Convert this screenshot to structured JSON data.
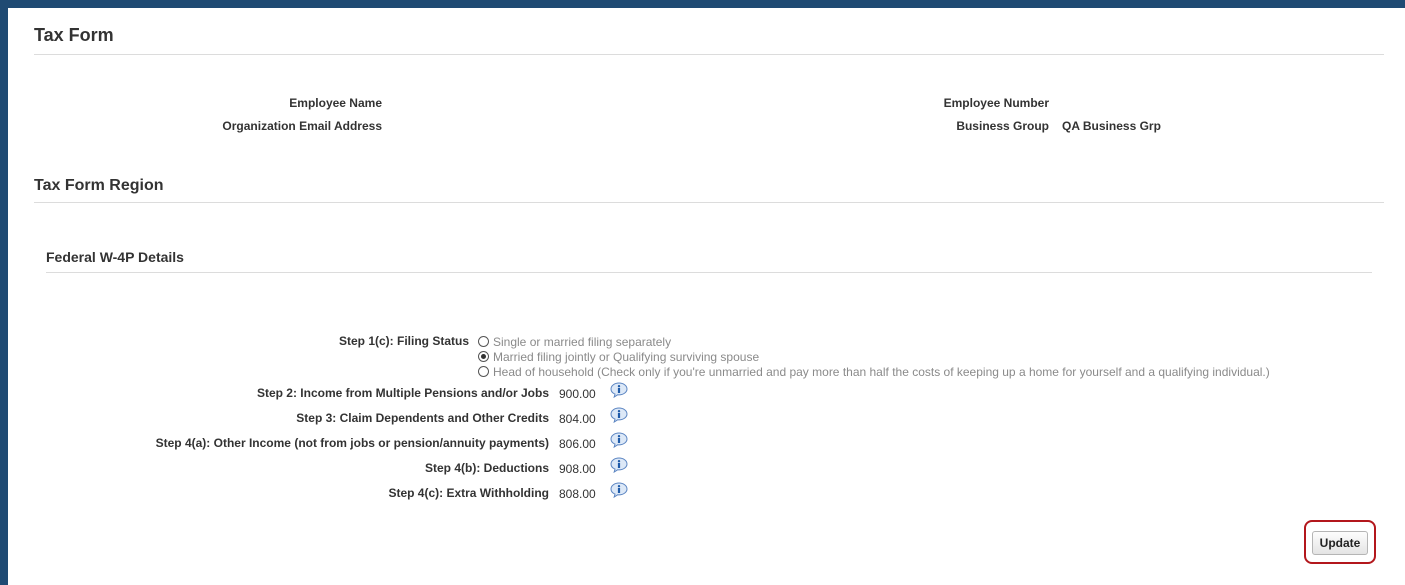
{
  "header": {
    "title": "Tax Form"
  },
  "employee": {
    "name_label": "Employee Name",
    "name_value": "",
    "email_label": "Organization Email Address",
    "email_value": "",
    "number_label": "Employee Number",
    "number_value": "",
    "business_group_label": "Business Group",
    "business_group_value": "QA Business Grp"
  },
  "region": {
    "title": "Tax Form Region"
  },
  "w4p": {
    "title": "Federal W-4P Details",
    "filing_status_label": "Step 1(c): Filing Status",
    "filing_options": [
      {
        "label": "Single or married filing separately",
        "selected": false
      },
      {
        "label": "Married filing jointly or Qualifying surviving spouse",
        "selected": true
      },
      {
        "label": "Head of household (Check only if you're unmarried and pay more than half the costs of keeping up a home for yourself and a qualifying individual.)",
        "selected": false
      }
    ],
    "steps": [
      {
        "label": "Step 2: Income from Multiple Pensions and/or Jobs",
        "value": "900.00"
      },
      {
        "label": "Step 3: Claim Dependents and Other Credits",
        "value": "804.00"
      },
      {
        "label": "Step 4(a): Other Income (not from jobs or pension/annuity payments)",
        "value": "806.00"
      },
      {
        "label": "Step 4(b): Deductions",
        "value": "908.00"
      },
      {
        "label": "Step 4(c): Extra Withholding",
        "value": "808.00"
      }
    ]
  },
  "actions": {
    "update_label": "Update"
  }
}
